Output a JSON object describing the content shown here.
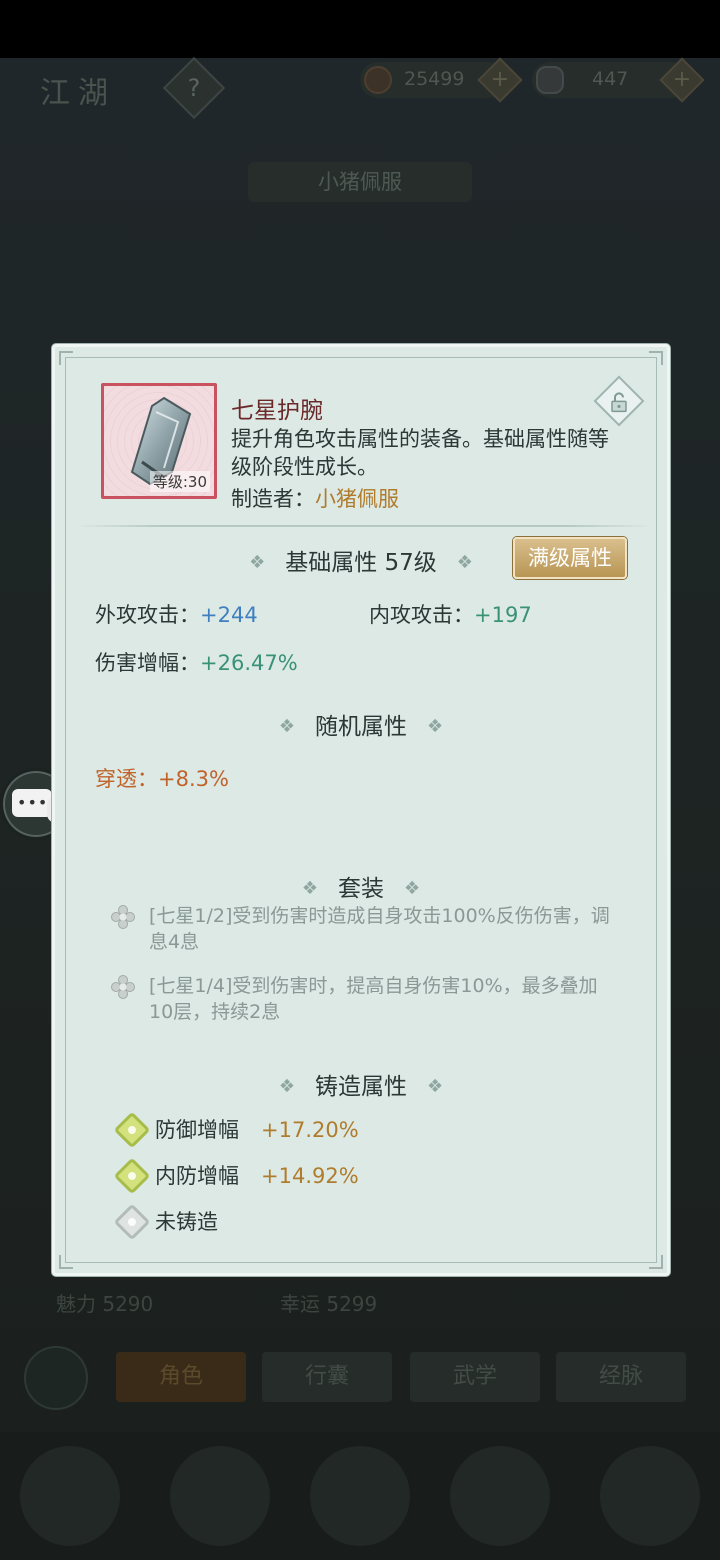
{
  "background": {
    "title": "江湖",
    "help": "?",
    "currencies": [
      {
        "icon": "copper-coin-icon",
        "amount": "25499",
        "plus": "+"
      },
      {
        "icon": "silver-ingot-icon",
        "amount": "447",
        "plus": "+"
      }
    ],
    "player_name": "小猪佩服",
    "stats": [
      {
        "label": "魅力",
        "value": "5290"
      },
      {
        "label": "幸运",
        "value": "5299"
      }
    ],
    "tabs": [
      "角色",
      "行囊",
      "武学",
      "经脉"
    ]
  },
  "item": {
    "name": "七星护腕",
    "description": "提升角色攻击属性的装备。基础属性随等级阶段性成长。",
    "level_label": "等级:30",
    "maker_prefix": "制造者：",
    "maker_name": "小猪佩服"
  },
  "base_attributes": {
    "title": "基础属性",
    "level": "57级",
    "full_level_button": "满级属性",
    "stats": [
      {
        "label": "外攻攻击：",
        "value": "+244"
      },
      {
        "label": "内攻攻击：",
        "value": "+197"
      },
      {
        "label": "伤害增幅：",
        "value": "+26.47%"
      }
    ]
  },
  "random_attributes": {
    "title": "随机属性",
    "stats": [
      {
        "label": "穿透：",
        "value": "+8.3%"
      }
    ]
  },
  "set_bonus": {
    "title": "套装",
    "entries": [
      "[七星1/2]受到伤害时造成自身攻击100%反伤伤害，调息4息",
      "[七星1/4]受到伤害时，提高自身伤害10%，最多叠加10层，持续2息"
    ]
  },
  "forge_attributes": {
    "title": "铸造属性",
    "entries": [
      {
        "label": "防御增幅",
        "value": "+17.20%",
        "active": true
      },
      {
        "label": "内防增幅",
        "value": "+14.92%",
        "active": true
      },
      {
        "label": "未铸造",
        "value": "",
        "active": false
      }
    ]
  },
  "colors": {
    "panel_bg": "#dce9e5",
    "item_frame": "#c8525f",
    "item_name": "#6b2a2a",
    "gold_text": "#b07c2c",
    "blue_value": "#3f7fbf",
    "green_value": "#3a9276",
    "orange_text": "#c0622a",
    "button_gold": "#c8a767"
  }
}
